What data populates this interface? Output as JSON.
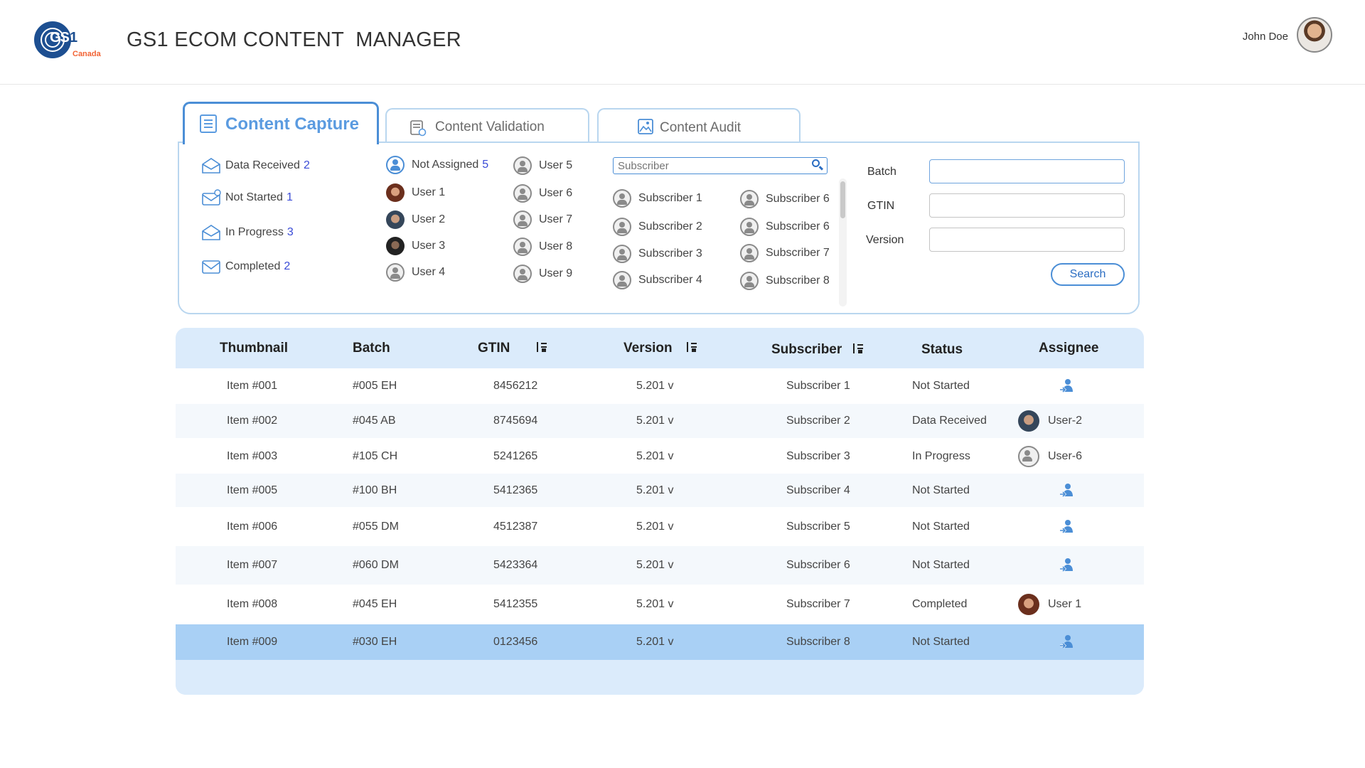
{
  "header": {
    "logo_text": "GS",
    "logo_superscript": "1",
    "logo_sub": "Canada",
    "title": "GS1 ECOM CONTENT  MANAGER",
    "user_name": "John Doe"
  },
  "tabs": [
    {
      "label": "Content Capture",
      "icon": "document-list-icon",
      "active": true
    },
    {
      "label": "Content Validation",
      "icon": "document-check-icon",
      "active": false
    },
    {
      "label": "Content Audit",
      "icon": "image-icon",
      "active": false
    }
  ],
  "statuses": [
    {
      "label": "Data Received",
      "count": "2",
      "icon": "envelope-open-icon"
    },
    {
      "label": "Not Started",
      "count": "1",
      "icon": "envelope-alert-icon"
    },
    {
      "label": "In Progress",
      "count": "3",
      "icon": "envelope-open-icon"
    },
    {
      "label": "Completed",
      "count": "2",
      "icon": "envelope-icon"
    }
  ],
  "users": {
    "not_assigned": {
      "label": "Not Assigned",
      "count": "5"
    },
    "col1": [
      "User 1",
      "User 2",
      "User 3",
      "User 4"
    ],
    "col2": [
      "User 5",
      "User 6",
      "User 7",
      "User 8",
      "User 9"
    ]
  },
  "subscribers": {
    "search_placeholder": "Subscriber",
    "col1": [
      "Subscriber 1",
      "Subscriber 2",
      "Subscriber 3",
      "Subscriber 4"
    ],
    "col2": [
      "Subscriber 6",
      "Subscriber 6",
      "Subscriber 7",
      "Subscriber 8"
    ]
  },
  "filters": {
    "batch_label": "Batch",
    "gtin_label": "GTIN",
    "version_label": "Version",
    "search_button": "Search"
  },
  "table": {
    "headers": {
      "thumbnail": "Thumbnail",
      "batch": "Batch",
      "gtin": "GTIN",
      "version": "Version",
      "subscriber": "Subscriber",
      "status": "Status",
      "assignee": "Assignee"
    },
    "rows": [
      {
        "thumbnail": "Item #001",
        "batch": "#005 EH",
        "gtin": "8456212",
        "version": "5.201 v",
        "subscriber": "Subscriber 1",
        "status": "Not Started",
        "assignee": ""
      },
      {
        "thumbnail": "Item #002",
        "batch": "#045 AB",
        "gtin": "8745694",
        "version": "5.201 v",
        "subscriber": "Subscriber 2",
        "status": "Data Received",
        "assignee": "User-2"
      },
      {
        "thumbnail": "Item #003",
        "batch": "#105 CH",
        "gtin": "5241265",
        "version": "5.201 v",
        "subscriber": "Subscriber 3",
        "status": "In Progress",
        "assignee": "User-6"
      },
      {
        "thumbnail": "Item #005",
        "batch": "#100 BH",
        "gtin": "5412365",
        "version": "5.201 v",
        "subscriber": "Subscriber 4",
        "status": "Not Started",
        "assignee": ""
      },
      {
        "thumbnail": "Item #006",
        "batch": "#055 DM",
        "gtin": "4512387",
        "version": "5.201 v",
        "subscriber": "Subscriber 5",
        "status": "Not Started",
        "assignee": ""
      },
      {
        "thumbnail": "Item #007",
        "batch": "#060 DM",
        "gtin": "5423364",
        "version": "5.201 v",
        "subscriber": "Subscriber 6",
        "status": "Not Started",
        "assignee": ""
      },
      {
        "thumbnail": "Item #008",
        "batch": "#045 EH",
        "gtin": "5412355",
        "version": "5.201 v",
        "subscriber": "Subscriber 7",
        "status": "Completed",
        "assignee": "User 1"
      },
      {
        "thumbnail": "Item #009",
        "batch": "#030 EH",
        "gtin": "0123456",
        "version": "5.201 v",
        "subscriber": "Subscriber 8",
        "status": "Not Started",
        "assignee": ""
      }
    ],
    "selected_row": 7
  },
  "colors": {
    "accent": "#4b8ed6",
    "count_text": "#3a4bd6",
    "table_header_bg": "#dbebfb",
    "row_alt_bg": "#f4f8fc",
    "row_selected_bg": "#a9d0f5",
    "logo_blue": "#1d4f91",
    "logo_orange": "#f26334"
  }
}
